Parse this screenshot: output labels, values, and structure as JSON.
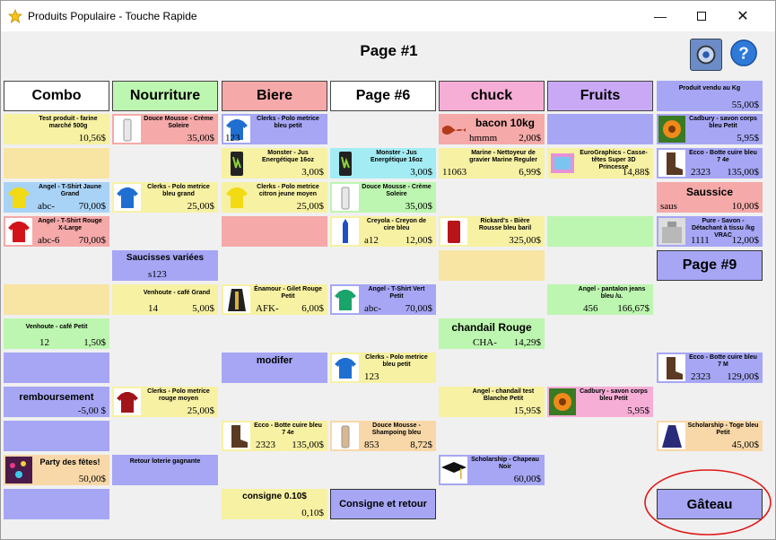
{
  "window": {
    "title": "Produits Populaire - Touche Rapide"
  },
  "page_label": "Page #1",
  "categories": [
    "Combo",
    "Nourriture",
    "Biere",
    "Page #6",
    "chuck",
    "Fruits"
  ],
  "colors": {
    "yellow": "#f7f1a3",
    "pink": "#f5a9a9",
    "peach": "#f8d8a8",
    "purple": "#a6a6f5",
    "cyan": "#a3ecf4",
    "green": "#bdf6b0",
    "ltpink": "#f6aed6",
    "blue": "#a9d3f6",
    "tan": "#f8e4a3"
  },
  "tiles": {
    "t1": {
      "name": "Test produit - farine marché 500g",
      "code": "",
      "price": "10,56$"
    },
    "t2": {
      "name": "Douce Mousse - Crème Soleire",
      "code": "",
      "price": "35,00$"
    },
    "t3": {
      "name": "Clerks - Polo metrice bleu petit",
      "code": "123",
      "price": ""
    },
    "t4": {
      "name": "bacon 10kg",
      "code": "hmmm",
      "price": "2,00$"
    },
    "t5": {
      "name": "Produit vendu au Kg",
      "code": "",
      "price": "55,00$"
    },
    "t6": {
      "name": "Cadbury - savon corps bleu Petit",
      "code": "",
      "price": "5,95$"
    },
    "t7": {
      "name": "Monster - Jus Energétique 16oz",
      "code": "",
      "price": "3,00$"
    },
    "t8": {
      "name": "Monster - Jus Energétique 16oz",
      "code": "",
      "price": "3,00$"
    },
    "t9": {
      "name": "Marine - Nettoyeur de gravier Marine Reguler",
      "code": "11063",
      "price": "6,99$"
    },
    "t10": {
      "name": "EuroGraphics - Casse-têtes Super 3D Princesse",
      "code": "",
      "price": "14,88$"
    },
    "t11": {
      "name": "Ecco - Botte cuire bleu 7 4e",
      "code": "2323",
      "price": "135,00$"
    },
    "t12": {
      "name": "Angel - T-Shirt Jaune Grand",
      "code": "abc-",
      "price": "70,00$"
    },
    "t13": {
      "name": "Clerks - Polo metrice bleu grand",
      "code": "",
      "price": "25,00$"
    },
    "t14": {
      "name": "Clerks - Polo metrice citron jeune moyen",
      "code": "",
      "price": "25,00$"
    },
    "t15": {
      "name": "Douce Mousse - Crème Soleire",
      "code": "",
      "price": "35,00$"
    },
    "t16": {
      "name": "Saussice",
      "code": "saus",
      "price": "10,00$"
    },
    "t17": {
      "name": "Angel - T-Shirt Rouge X-Large",
      "code": "abc-6",
      "price": "70,00$"
    },
    "t18": {
      "name": "Creyola - Creyon de cire bleu",
      "code": "a12",
      "price": "12,00$"
    },
    "t19": {
      "name": "Rickard's - Bière Rousse bleu baril",
      "code": "",
      "price": "325,00$"
    },
    "t20": {
      "name": "Pure - Savon - Détachant à tissu /kg VRAC",
      "code": "1111",
      "price": "12,00$"
    },
    "t21": {
      "name": "Saucisses variées",
      "code": "s123",
      "price": ""
    },
    "t22": {
      "name": "Venhoute - café Grand",
      "code": "14",
      "price": "5,00$"
    },
    "t23": {
      "name": "Énamour - Gilet Rouge Petit",
      "code": "AFK-",
      "price": "6,00$"
    },
    "t24": {
      "name": "Angel - T-Shirt Vert Petit",
      "code": "abc-",
      "price": "70,00$"
    },
    "t25": {
      "name": "Angel - pantalon jeans bleu /u.",
      "code": "456",
      "price": "166,67$"
    },
    "t26": {
      "name": "Venhoute - café Petit",
      "code": "12",
      "price": "1,50$"
    },
    "t27": {
      "name": "chandail Rouge",
      "code": "CHA-",
      "price": "14,29$"
    },
    "t28": {
      "name": "modifer",
      "code": "",
      "price": ""
    },
    "t29": {
      "name": "Clerks - Polo metrice bleu petit",
      "code": "123",
      "price": ""
    },
    "t30": {
      "name": "Ecco - Botte cuire bleu 7 M",
      "code": "2323",
      "price": "129,00$"
    },
    "t31": {
      "name": "remboursement",
      "code": "",
      "price": "-5,00 $"
    },
    "t32": {
      "name": "Clerks - Polo metrice rouge moyen",
      "code": "",
      "price": "25,00$"
    },
    "t33": {
      "name": "Angel - chandail test Blanche Petit",
      "code": "",
      "price": "15,95$"
    },
    "t34": {
      "name": "Cadbury - savon corps bleu Petit",
      "code": "",
      "price": "5,95$"
    },
    "t35": {
      "name": "Ecco - Botte cuire bleu 7 4e",
      "code": "2323",
      "price": "135,00$"
    },
    "t36": {
      "name": "Douce Mousse - Shampoing bleu",
      "code": "853",
      "price": "8,72$"
    },
    "t37": {
      "name": "Scholarship - Toge bleu Petit",
      "code": "",
      "price": "45,00$"
    },
    "t38": {
      "name": "Party des fêtes!",
      "code": "",
      "price": "50,00$"
    },
    "t39": {
      "name": "Retour loterie gagnante",
      "code": "",
      "price": ""
    },
    "t40": {
      "name": "Scholarship - Chapeau Noir",
      "code": "",
      "price": "60,00$"
    },
    "t41": {
      "name": "consigne 0.10$",
      "code": "",
      "price": "0,10$"
    }
  },
  "nav": {
    "page9": "Page #9",
    "consigne": "Consigne et retour",
    "gateau": "Gâteau"
  }
}
